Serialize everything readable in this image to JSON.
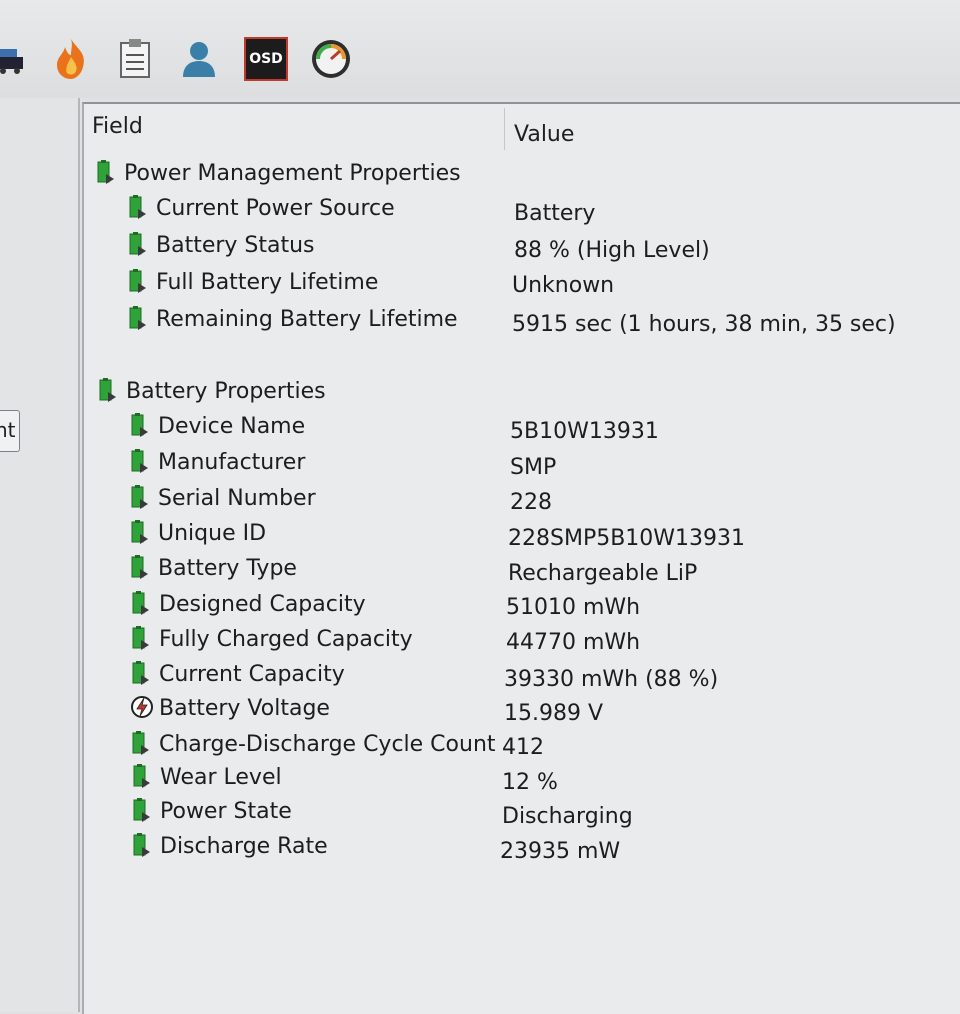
{
  "toolbar": {
    "icons": [
      "truck-icon",
      "flame-icon",
      "checklist-icon",
      "user-icon",
      "osd-icon",
      "gauge-icon"
    ],
    "osd_label": "OSD"
  },
  "left_pane": {
    "tab_label": "nt"
  },
  "grid": {
    "headers": {
      "field": "Field",
      "value": "Value"
    },
    "sections": [
      {
        "title": "Power Management Properties",
        "rows": [
          {
            "field": "Current Power Source",
            "value": "Battery"
          },
          {
            "field": "Battery Status",
            "value": "88 % (High Level)"
          },
          {
            "field": "Full Battery Lifetime",
            "value": "Unknown"
          },
          {
            "field": "Remaining Battery Lifetime",
            "value": "5915 sec (1 hours, 38 min, 35 sec)"
          }
        ]
      },
      {
        "title": "Battery Properties",
        "rows": [
          {
            "field": "Device Name",
            "value": "5B10W13931"
          },
          {
            "field": "Manufacturer",
            "value": "SMP"
          },
          {
            "field": "Serial Number",
            "value": "228"
          },
          {
            "field": "Unique ID",
            "value": "228SMP5B10W13931"
          },
          {
            "field": "Battery Type",
            "value": "Rechargeable LiP"
          },
          {
            "field": "Designed Capacity",
            "value": "51010 mWh"
          },
          {
            "field": "Fully Charged Capacity",
            "value": "44770 mWh"
          },
          {
            "field": "Current Capacity",
            "value": "39330 mWh  (88 %)"
          },
          {
            "field": "Battery Voltage",
            "value": "15.989 V",
            "icon": "voltage-icon"
          },
          {
            "field": "Charge-Discharge Cycle Count",
            "value": "412"
          },
          {
            "field": "Wear Level",
            "value": "12 %"
          },
          {
            "field": "Power State",
            "value": "Discharging"
          },
          {
            "field": "Discharge Rate",
            "value": "23935 mW"
          }
        ]
      }
    ]
  },
  "colors": {
    "battery_icon": "#2fa33a",
    "voltage_icon": "#c0392b",
    "osd_bg": "#1c1c1c",
    "osd_border": "#c0392b"
  }
}
